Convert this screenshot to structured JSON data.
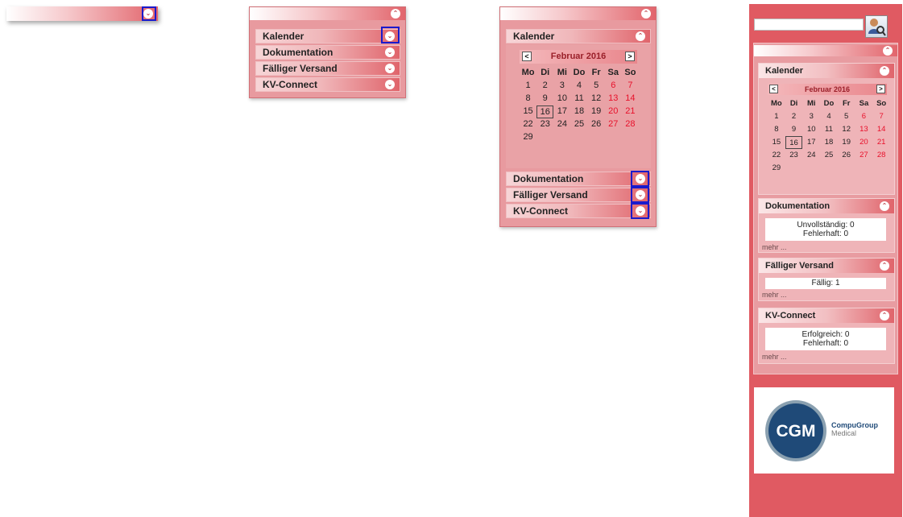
{
  "toggle_up_glyph": "⌃",
  "toggle_down_glyph": "⌄",
  "sections": {
    "kalender": "Kalender",
    "dokumentation": "Dokumentation",
    "versand": "Fälliger Versand",
    "kv": "KV-Connect"
  },
  "calendar": {
    "month": "Februar 2016",
    "prev": "<",
    "next": ">",
    "weekdays": [
      "Mo",
      "Di",
      "Mi",
      "Do",
      "Fr",
      "Sa",
      "So"
    ],
    "weeks": [
      [
        "",
        "",
        "",
        "",
        "",
        "",
        ""
      ],
      [
        "1",
        "2",
        "3",
        "4",
        "5",
        "6",
        "7"
      ],
      [
        "8",
        "9",
        "10",
        "11",
        "12",
        "13",
        "14"
      ],
      [
        "15",
        "16",
        "17",
        "18",
        "19",
        "20",
        "21"
      ],
      [
        "22",
        "23",
        "24",
        "25",
        "26",
        "27",
        "28"
      ],
      [
        "29",
        "",
        "",
        "",
        "",
        "",
        ""
      ]
    ],
    "today": "16"
  },
  "doku": {
    "unvollstaendig": "Unvollständig: 0",
    "fehlerhaft": "Fehlerhaft: 0",
    "more": "mehr ..."
  },
  "versand": {
    "faellig": "Fällig: 1",
    "more": "mehr ..."
  },
  "kv": {
    "erfolgreich": "Erfolgreich: 0",
    "fehlerhaft": "Fehlerhaft: 0",
    "more": "mehr ..."
  },
  "logo": {
    "mark": "CGM",
    "line1": "CompuGroup",
    "line2": "Medical"
  },
  "colors": {
    "accent": "#e05a62",
    "weekend": "#e8102a",
    "highlight": "#1a1acc"
  }
}
